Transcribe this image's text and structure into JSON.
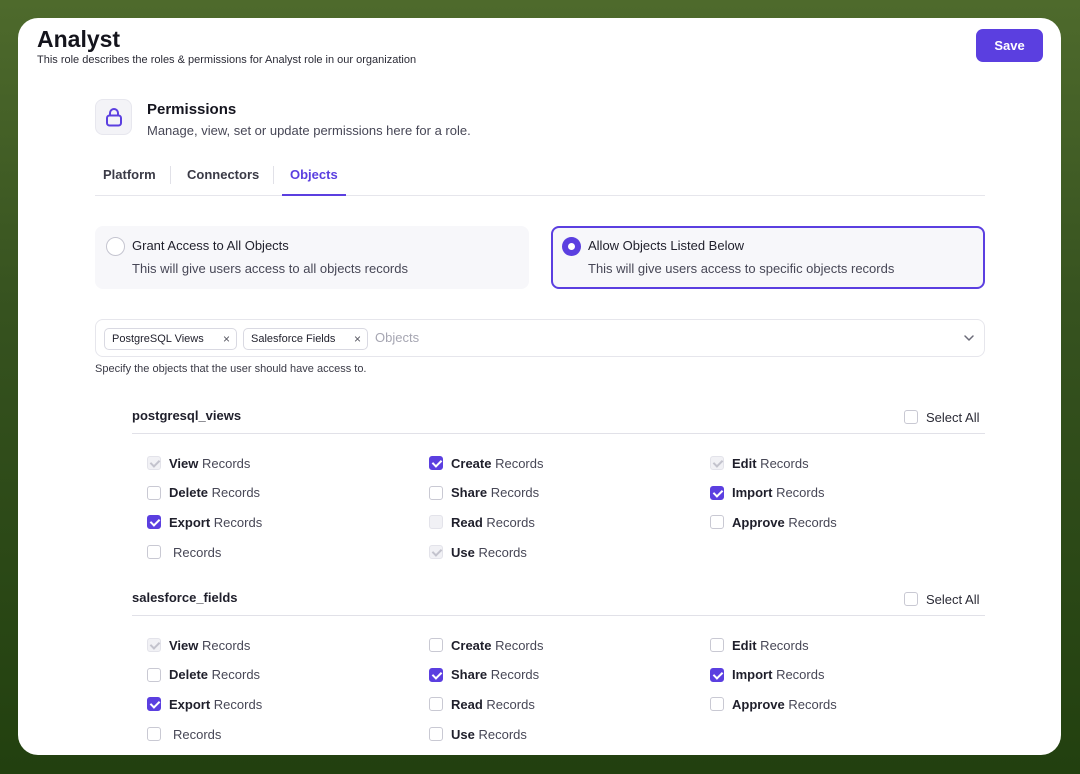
{
  "header": {
    "title": "Analyst",
    "subtitle": "This role describes the roles & permissions for Analyst role in our organization",
    "save_label": "Save"
  },
  "permissions": {
    "icon": "lock-icon",
    "title": "Permissions",
    "subtitle": "Manage, view, set or update permissions here for a role."
  },
  "tabs": [
    {
      "label": "Platform",
      "active": false
    },
    {
      "label": "Connectors",
      "active": false
    },
    {
      "label": "Objects",
      "active": true
    }
  ],
  "access_options": [
    {
      "title": "Grant Access to All Objects",
      "subtitle": "This will give users access to all objects records",
      "selected": false
    },
    {
      "title": "Allow Objects Listed Below",
      "subtitle": "This will give users access to specific objects records",
      "selected": true
    }
  ],
  "object_selector": {
    "chips": [
      "PostgreSQL Views",
      "Salesforce Fields"
    ],
    "chip_remove_glyph": "×",
    "placeholder": "Objects",
    "helper": "Specify the objects that the user should have access to."
  },
  "sections": [
    {
      "name": "postgresql_views",
      "select_all_label": "Select All",
      "select_all_checked": false,
      "items": [
        {
          "bold": "View",
          "rest": " Records",
          "state": "disabled-checked"
        },
        {
          "bold": "Create",
          "rest": " Records",
          "state": "checked"
        },
        {
          "bold": "Edit",
          "rest": " Records",
          "state": "disabled-checked"
        },
        {
          "bold": "Delete",
          "rest": " Records",
          "state": "unchecked"
        },
        {
          "bold": "Share",
          "rest": " Records",
          "state": "unchecked"
        },
        {
          "bold": "Import",
          "rest": " Records",
          "state": "checked"
        },
        {
          "bold": "Export",
          "rest": " Records",
          "state": "checked"
        },
        {
          "bold": "Read",
          "rest": " Records",
          "state": "disabled"
        },
        {
          "bold": "Approve",
          "rest": " Records",
          "state": "unchecked"
        },
        {
          "bold": "",
          "rest": "Records",
          "state": "unchecked"
        },
        {
          "bold": "Use",
          "rest": " Records",
          "state": "disabled-checked"
        }
      ]
    },
    {
      "name": "salesforce_fields",
      "select_all_label": "Select All",
      "select_all_checked": false,
      "items": [
        {
          "bold": "View",
          "rest": " Records",
          "state": "disabled-checked"
        },
        {
          "bold": "Create",
          "rest": " Records",
          "state": "unchecked"
        },
        {
          "bold": "Edit",
          "rest": " Records",
          "state": "unchecked"
        },
        {
          "bold": "Delete",
          "rest": " Records",
          "state": "unchecked"
        },
        {
          "bold": "Share",
          "rest": " Records",
          "state": "checked"
        },
        {
          "bold": "Import",
          "rest": " Records",
          "state": "checked"
        },
        {
          "bold": "Export",
          "rest": " Records",
          "state": "checked"
        },
        {
          "bold": "Read",
          "rest": " Records",
          "state": "unchecked"
        },
        {
          "bold": "Approve",
          "rest": " Records",
          "state": "unchecked"
        },
        {
          "bold": "",
          "rest": "Records",
          "state": "unchecked"
        },
        {
          "bold": "Use",
          "rest": " Records",
          "state": "unchecked"
        }
      ]
    }
  ],
  "colors": {
    "accent": "#5b3fe0",
    "background_top": "#4e6a2c",
    "background_bottom": "#22400f"
  }
}
